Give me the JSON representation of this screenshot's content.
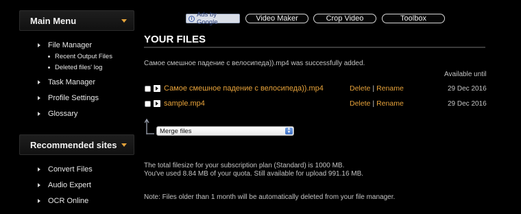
{
  "sidebar": {
    "main_menu": {
      "title": "Main Menu",
      "items": [
        {
          "label": "File Manager",
          "subitems": [
            "Recent Output Files",
            "Deleted files' log"
          ]
        },
        {
          "label": "Task Manager"
        },
        {
          "label": "Profile Settings"
        },
        {
          "label": "Glossary"
        }
      ]
    },
    "recommended": {
      "title": "Recommended sites",
      "items": [
        "Convert Files",
        "Audio Expert",
        "OCR Online"
      ]
    }
  },
  "topbar": {
    "ads_label": "Ads by Google",
    "buttons": [
      "Video Maker",
      "Crop Video",
      "Toolbox"
    ]
  },
  "main": {
    "title": "YOUR FILES",
    "success_message": "Самое смешное падение с велосипеда)).mp4 was successfully added.",
    "available_until_header": "Available until",
    "files": [
      {
        "name": "Самое смешное падение с велосипеда)).mp4",
        "delete": "Delete",
        "separator": "|",
        "rename": "Rename",
        "date": "29 Dec 2016"
      },
      {
        "name": "sample.mp4",
        "delete": "Delete",
        "separator": "|",
        "rename": "Rename",
        "date": "29 Dec 2016"
      }
    ],
    "merge_select": {
      "value": "Merge files"
    },
    "quota_line1": "The total filesize for your subscription plan (Standard) is 1000 MB.",
    "quota_line2": "You've used 8.84 MB of your quota. Still available for upload 991.16 MB.",
    "note": "Note: Files older than 1 month will be automatically deleted from your file manager."
  },
  "colors": {
    "accent": "#e8a33a",
    "background": "#000000"
  }
}
